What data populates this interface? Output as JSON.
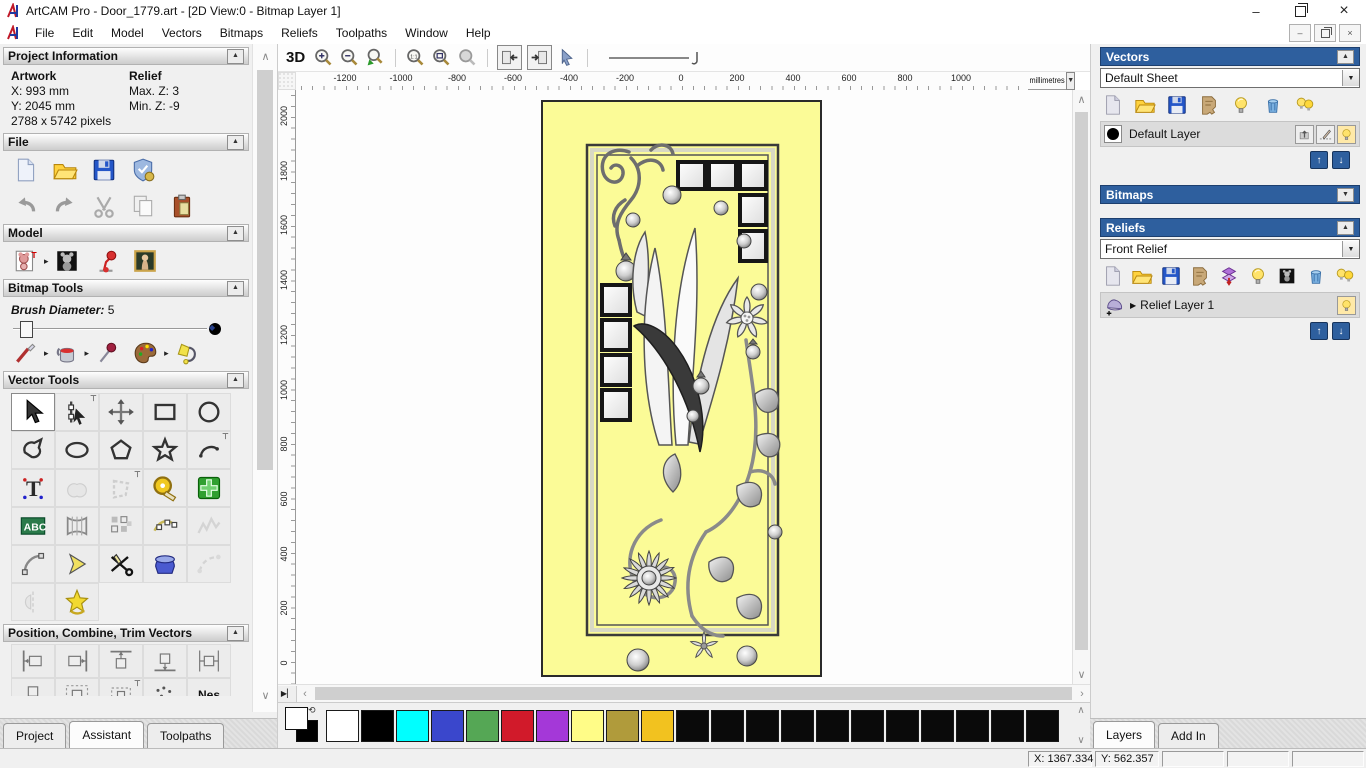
{
  "titlebar": {
    "title": "ArtCAM Pro - Door_1779.art - [2D View:0 - Bitmap Layer 1]",
    "minimize": "–",
    "close": "×"
  },
  "menubar": {
    "items": [
      "File",
      "Edit",
      "Model",
      "Vectors",
      "Bitmaps",
      "Reliefs",
      "Toolpaths",
      "Window",
      "Help"
    ]
  },
  "assistant_panel": {
    "project_info": {
      "header": "Project Information",
      "artwork_label": "Artwork",
      "relief_label": "Relief",
      "artwork_x": "X: 993 mm",
      "relief_max": "Max. Z: 3",
      "artwork_y": "Y: 2045 mm",
      "relief_min": "Min. Z: -9",
      "pixels": "2788 x 5742 pixels"
    },
    "file": {
      "header": "File",
      "icons_row1": [
        "new-model",
        "open-model",
        "save-model",
        "model-properties"
      ],
      "icons_row2": [
        "undo",
        "redo",
        "cut",
        "copy",
        "paste"
      ]
    },
    "model": {
      "header": "Model",
      "icons": [
        "greyscale-from-model",
        "flyout",
        "invert-model",
        "render-model",
        "load-bitmap"
      ]
    },
    "bitmap_tools": {
      "header": "Bitmap Tools",
      "brush_label": "Brush Diameter:",
      "brush_value": "5",
      "icons": [
        "paint-brush",
        "flyout",
        "paint-bucket",
        "flyout",
        "colour-picker",
        "palette",
        "flyout",
        "flood-fill"
      ]
    },
    "vector_tools": {
      "header": "Vector Tools",
      "rows": [
        [
          {
            "icon": "select-vectors",
            "state": "active"
          },
          {
            "icon": "node-editing",
            "pin": true
          },
          {
            "icon": "transform-vectors"
          },
          {
            "icon": "create-rectangle"
          },
          {
            "icon": "create-circle"
          }
        ],
        [
          {
            "icon": "create-polyline"
          },
          {
            "icon": "create-ellipse"
          },
          {
            "icon": "create-polygon"
          },
          {
            "icon": "create-star"
          },
          {
            "icon": "create-arc",
            "pin": true
          }
        ],
        [
          {
            "icon": "create-text"
          },
          {
            "icon": "weld-vectors",
            "state": "disabled"
          },
          {
            "icon": "trim-vectors",
            "state": "disabled",
            "pin": true
          },
          {
            "icon": "measure-tool"
          },
          {
            "icon": "offset-vectors"
          }
        ],
        [
          {
            "icon": "text-in-a-box"
          },
          {
            "icon": "envelope-distortion"
          },
          {
            "icon": "block-copy"
          },
          {
            "icon": "paste-along-curve"
          },
          {
            "icon": "vector-texture",
            "state": "disabled"
          }
        ],
        [
          {
            "icon": "fillet-tool"
          },
          {
            "icon": "join-vectors"
          },
          {
            "icon": "cut-vectors"
          },
          {
            "icon": "spin-tool"
          },
          {
            "icon": "fit-arcs",
            "state": "disabled"
          }
        ],
        [
          {
            "icon": "mirror-vectors",
            "state": "disabled"
          },
          {
            "icon": "vector-doctor"
          }
        ]
      ]
    },
    "position_tools": {
      "header": "Position, Combine, Trim Vectors",
      "rows": [
        [
          {
            "icon": "align-left"
          },
          {
            "icon": "align-right"
          },
          {
            "icon": "align-top"
          },
          {
            "icon": "align-bottom"
          },
          {
            "icon": "align-center-h"
          }
        ],
        [
          {
            "icon": "align-center-v"
          },
          {
            "icon": "align-in-rectangle"
          },
          {
            "icon": "align-contour",
            "pin": true
          },
          {
            "icon": "nudge-dots"
          },
          {
            "icon": "nesting",
            "text": "Nes"
          }
        ]
      ]
    },
    "tabs": [
      {
        "label": "Project",
        "active": false
      },
      {
        "label": "Assistant",
        "active": true
      },
      {
        "label": "Toolpaths",
        "active": false
      }
    ]
  },
  "view_toolbar": {
    "label_3d": "3D",
    "icons": [
      {
        "icon": "zoom-in"
      },
      {
        "icon": "zoom-out"
      },
      {
        "icon": "zoom-previous"
      },
      "sep",
      {
        "icon": "zoom-scale"
      },
      {
        "icon": "zoom-fit"
      },
      {
        "icon": "zoom-object"
      },
      "sep",
      {
        "icon": "toggle-bitmap",
        "boxed": true
      },
      {
        "icon": "toggle-vector",
        "boxed": true
      },
      {
        "icon": "draw-cursor"
      },
      "sep"
    ]
  },
  "rulers": {
    "units": "millimetres",
    "h_ticks": [
      "-1200",
      "-1000",
      "-800",
      "-600",
      "-400",
      "-200",
      "0",
      "200",
      "400",
      "600",
      "800",
      "1000"
    ],
    "v_ticks": [
      "2000",
      "1800",
      "1600",
      "1400",
      "1200",
      "1000",
      "800",
      "600",
      "400",
      "200",
      "0"
    ]
  },
  "vectors_panel": {
    "header": "Vectors",
    "sheet": "Default Sheet",
    "toolbar_icons": [
      "new-layer",
      "open-model",
      "save-model",
      "import-paper",
      "bulb",
      "delete-trash",
      "bulbs"
    ],
    "layer": {
      "name": "Default Layer",
      "swatch": "#000000",
      "buttons": [
        "layer-merge",
        "layer-snap",
        "bulb"
      ]
    }
  },
  "bitmaps_panel": {
    "header": "Bitmaps"
  },
  "reliefs_panel": {
    "header": "Reliefs",
    "relief": "Front Relief",
    "toolbar_icons": [
      "new-layer",
      "open-model",
      "save-model",
      "import-paper",
      "merge-layers",
      "bulb",
      "greyscale-bitmap",
      "delete-trash",
      "bulbs"
    ],
    "layer": {
      "name": "Relief Layer 1",
      "expander": "▶",
      "buttons": [
        "bulb"
      ]
    }
  },
  "right_tabs": [
    {
      "label": "Layers",
      "active": true
    },
    {
      "label": "Add In",
      "active": false
    }
  ],
  "palette": {
    "colors": [
      "#ffffff",
      "#000000",
      "#00ffff",
      "#3a47cc",
      "#55a755",
      "#d11a2a",
      "#a438d8",
      "#fffc87",
      "#b09b3b",
      "#f2c21f",
      "#0a0a0a",
      "#0a0a0a",
      "#0a0a0a",
      "#0a0a0a",
      "#0a0a0a",
      "#0a0a0a",
      "#0a0a0a",
      "#0a0a0a",
      "#0a0a0a",
      "#0a0a0a",
      "#0a0a0a"
    ],
    "primary": "#ffffff",
    "secondary": "#000000"
  },
  "statusbar": {
    "x_label": "X: 1367.334",
    "y_label": "Y: 562.357"
  },
  "canvas": {
    "door_fill": "#fbfb97"
  }
}
